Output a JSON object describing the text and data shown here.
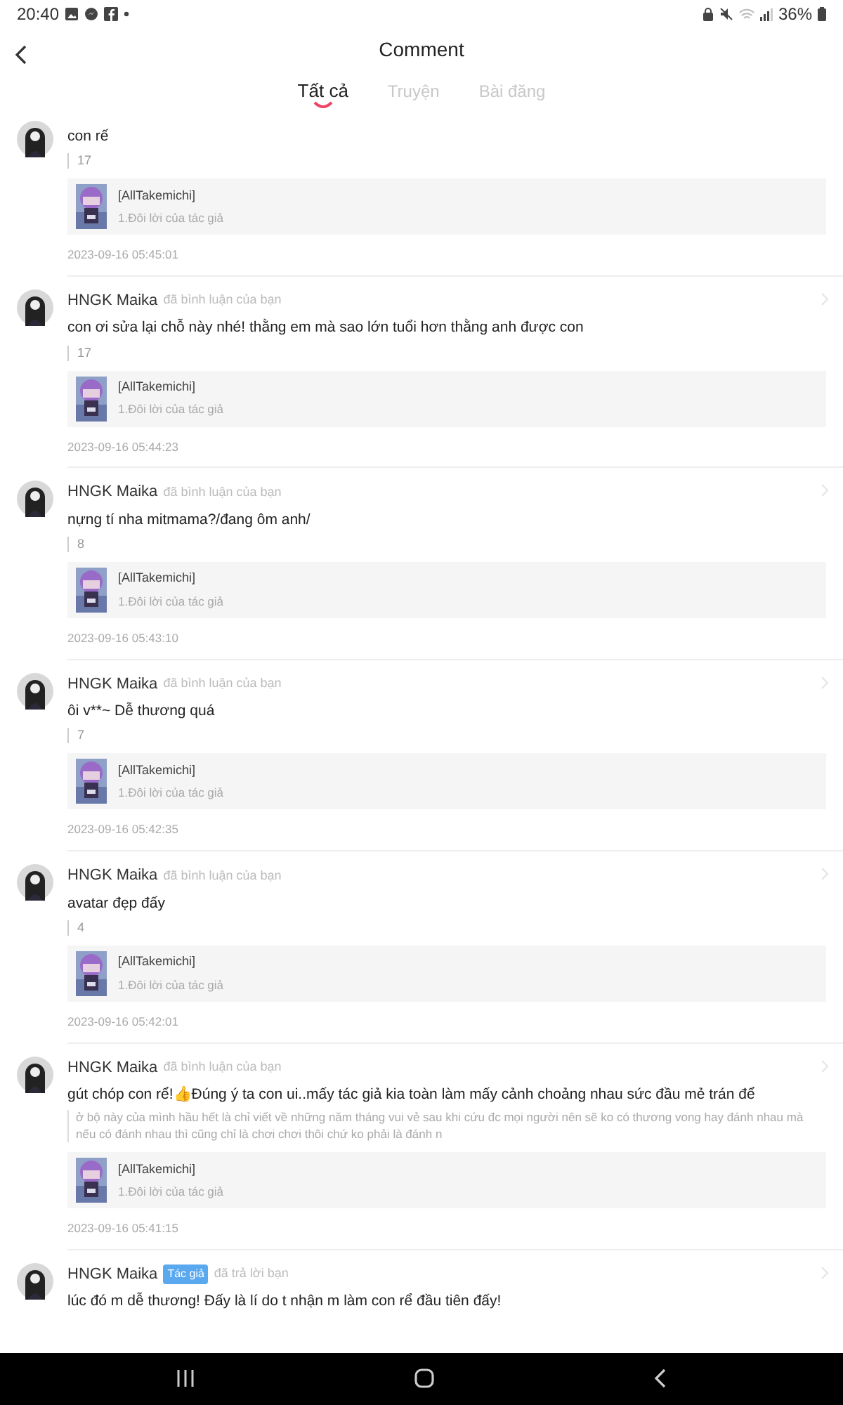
{
  "status_bar": {
    "time": "20:40",
    "battery": "36%"
  },
  "header": {
    "title": "Comment"
  },
  "tabs": [
    {
      "label": "Tất cả",
      "selected": true
    },
    {
      "label": "Truyện",
      "selected": false
    },
    {
      "label": "Bài đăng",
      "selected": false
    }
  ],
  "comments": [
    {
      "content": "con rế",
      "count": "17",
      "book": {
        "title": "[AllTakemichi]",
        "chapter": "1.Đôi lời của tác giả"
      },
      "date": "2023-09-16 05:45:01"
    },
    {
      "author": "HNGK Maika",
      "action": "đã bình luận của bạn",
      "content": "con ơi sửa lại chỗ này nhé! thằng em mà sao lớn tuổi hơn thằng anh được con",
      "count": "17",
      "book": {
        "title": "[AllTakemichi]",
        "chapter": "1.Đôi lời của tác giả"
      },
      "date": "2023-09-16 05:44:23"
    },
    {
      "author": "HNGK Maika",
      "action": "đã bình luận của bạn",
      "content": "nựng tí nha mitmama?/đang ôm anh/",
      "count": "8",
      "book": {
        "title": "[AllTakemichi]",
        "chapter": "1.Đôi lời của tác giả"
      },
      "date": "2023-09-16 05:43:10"
    },
    {
      "author": "HNGK Maika",
      "action": "đã bình luận của bạn",
      "content": "ôi v**~ Dễ thương quá",
      "count": "7",
      "book": {
        "title": "[AllTakemichi]",
        "chapter": "1.Đôi lời của tác giả"
      },
      "date": "2023-09-16 05:42:35"
    },
    {
      "author": "HNGK Maika",
      "action": "đã bình luận của bạn",
      "content": "avatar đẹp đấy",
      "count": "4",
      "book": {
        "title": "[AllTakemichi]",
        "chapter": "1.Đôi lời của tác giả"
      },
      "date": "2023-09-16 05:42:01"
    },
    {
      "author": "HNGK Maika",
      "action": "đã bình luận của bạn",
      "content": "gút chóp con rể!👍Đúng ý ta con ui..mấy tác giả kia toàn làm mấy cảnh choảng nhau sức đầu mẻ trán để",
      "quote": "ở bộ này của mình hầu hết là chỉ viết về những năm tháng vui vẻ sau khi cứu đc mọi người nên sẽ ko có thương vong hay đánh nhau mà nếu có đánh nhau thì cũng chỉ là chơi chơi thôi chứ ko phải là đánh n",
      "book": {
        "title": "[AllTakemichi]",
        "chapter": "1.Đôi lời của tác giả"
      },
      "date": "2023-09-16 05:41:15"
    },
    {
      "author": "HNGK Maika",
      "badge": "Tác giả",
      "action": "đã trả lời bạn",
      "content": "lúc đó m dễ thương! Đấy là lí do t nhận m làm con rể đầu tiên đấy!"
    }
  ]
}
